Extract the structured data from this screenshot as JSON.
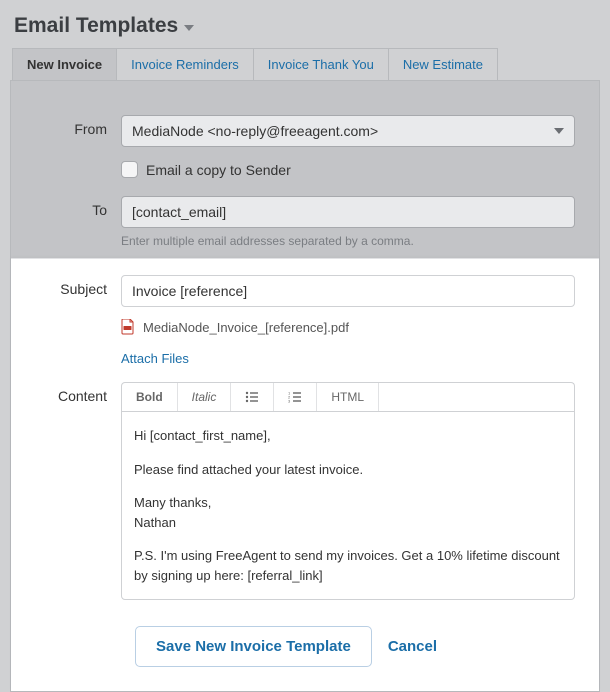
{
  "header": {
    "title": "Email Templates"
  },
  "tabs": [
    {
      "label": "New Invoice",
      "active": true
    },
    {
      "label": "Invoice Reminders",
      "active": false
    },
    {
      "label": "Invoice Thank You",
      "active": false
    },
    {
      "label": "New Estimate",
      "active": false
    }
  ],
  "form": {
    "from_label": "From",
    "from_value": "MediaNode <no-reply@freeagent.com>",
    "copy_checkbox_label": "Email a copy to Sender",
    "to_label": "To",
    "to_value": "[contact_email]",
    "to_hint": "Enter multiple email addresses separated by a comma.",
    "subject_label": "Subject",
    "subject_value": "Invoice [reference]",
    "attachment_name": "MediaNode_Invoice_[reference].pdf",
    "attach_files_label": "Attach Files",
    "content_label": "Content",
    "toolbar": {
      "bold": "Bold",
      "italic": "Italic",
      "html": "HTML"
    },
    "content_body": {
      "p1": "Hi [contact_first_name],",
      "p2": "Please find attached your latest invoice.",
      "p3a": "Many thanks,",
      "p3b": "Nathan",
      "p4": "P.S. I'm using FreeAgent to send my invoices. Get a 10% lifetime discount by signing up here: [referral_link]"
    }
  },
  "actions": {
    "save": "Save New Invoice Template",
    "cancel": "Cancel"
  }
}
